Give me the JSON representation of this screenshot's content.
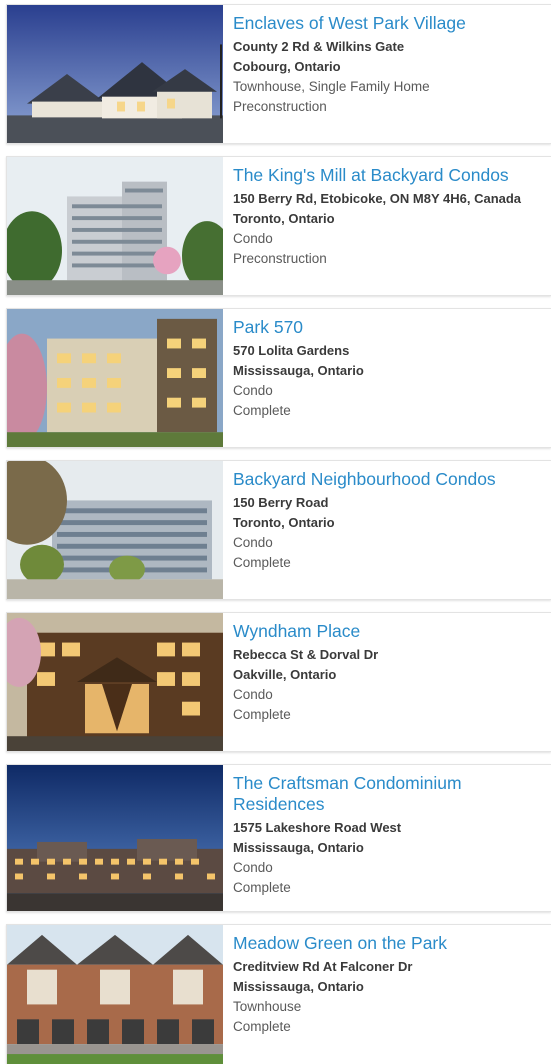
{
  "listings": [
    {
      "title": "Enclaves of West Park Village",
      "address": "County 2 Rd & Wilkins Gate",
      "city": "Cobourg, Ontario",
      "type": "Townhouse, Single Family Home",
      "status": "Preconstruction",
      "image_icon": "townhouse-rendering-image"
    },
    {
      "title": "The King's Mill at Backyard Condos",
      "address": "150 Berry Rd, Etobicoke, ON M8Y 4H6, Canada",
      "city": "Toronto, Ontario",
      "type": "Condo",
      "status": "Preconstruction",
      "image_icon": "condo-tower-rendering-image"
    },
    {
      "title": "Park 570",
      "address": "570 Lolita Gardens",
      "city": "Mississauga, Ontario",
      "type": "Condo",
      "status": "Complete",
      "image_icon": "midrise-condo-rendering-image"
    },
    {
      "title": "Backyard Neighbourhood Condos",
      "address": "150 Berry Road",
      "city": "Toronto, Ontario",
      "type": "Condo",
      "status": "Complete",
      "image_icon": "glass-condo-rendering-image"
    },
    {
      "title": "Wyndham Place",
      "address": "Rebecca St & Dorval Dr",
      "city": "Oakville, Ontario",
      "type": "Condo",
      "status": "Complete",
      "image_icon": "wood-condo-rendering-image"
    },
    {
      "title": "The Craftsman Condominium Residences",
      "address": "1575 Lakeshore Road West",
      "city": "Mississauga, Ontario",
      "type": "Condo",
      "status": "Complete",
      "image_icon": "night-condo-rendering-image"
    },
    {
      "title": "Meadow Green on the Park",
      "address": "Creditview Rd At Falconer Dr",
      "city": "Mississauga, Ontario",
      "type": "Townhouse",
      "status": "Complete",
      "image_icon": "brick-townhouse-rendering-image"
    }
  ],
  "colors": {
    "title": "#2a8bc9",
    "address": "#3a3a3a",
    "meta": "#5a5a5a",
    "border": "#e3e3e3"
  }
}
